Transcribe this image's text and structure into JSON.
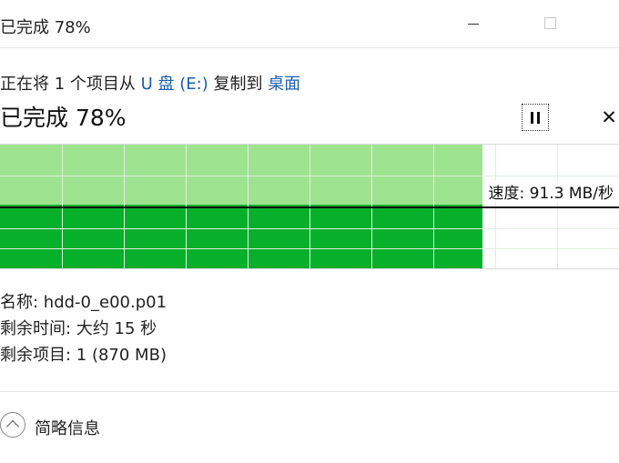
{
  "window": {
    "title": "已完成 78%"
  },
  "copy": {
    "prefix": "正在将 1 个项目从 ",
    "source": "U 盘 (E:)",
    "middle": " 复制到 ",
    "destination": "桌面"
  },
  "progress": {
    "title": "已完成 78%",
    "percent": 78,
    "speed_label": "速度: 91.3 MB/秒"
  },
  "details": {
    "name": "名称: hdd-0_e00.p01",
    "time_remaining": "剩余时间: 大约 15 秒",
    "items_remaining": "剩余项目: 1 (870 MB)"
  },
  "footer": {
    "toggle_label": "简略信息"
  },
  "colors": {
    "fill_light": "#9ee38f",
    "fill_dark": "#06b02b",
    "link": "#1a5fb4"
  }
}
